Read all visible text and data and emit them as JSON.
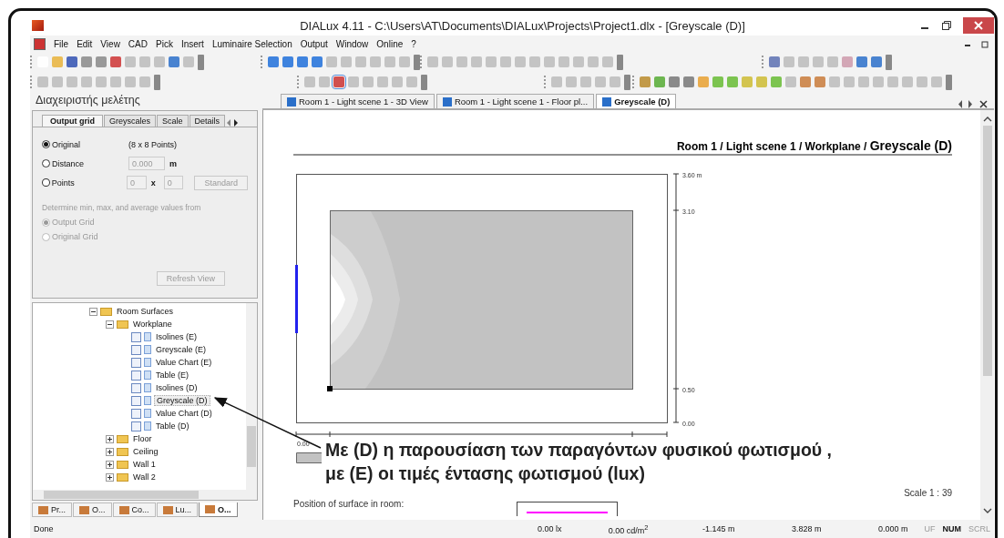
{
  "window": {
    "title": "DIALux 4.11 - C:\\Users\\AT\\Documents\\DIALux\\Projects\\Project1.dlx - [Greyscale (D)]"
  },
  "menu": [
    "File",
    "Edit",
    "View",
    "CAD",
    "Pick",
    "Insert",
    "Luminaire Selection",
    "Output",
    "Window",
    "Online",
    "?"
  ],
  "sidebar": {
    "title": "Διαχειριστής μελέτης",
    "tabs": [
      {
        "label": "Output grid",
        "selected": true
      },
      {
        "label": "Greyscales",
        "selected": false
      },
      {
        "label": "Scale",
        "selected": false
      },
      {
        "label": "Details",
        "selected": false
      }
    ],
    "grid_options": [
      {
        "label": "Original",
        "selected": true,
        "kind": "info",
        "info": "(8 x 8 Points)"
      },
      {
        "label": "Distance",
        "selected": false,
        "kind": "distance",
        "value": "0.000",
        "unit": "m"
      },
      {
        "label": "Points",
        "selected": false,
        "kind": "points",
        "value_1": "0",
        "separator": "x",
        "value_2": "0",
        "button": "Standard"
      }
    ],
    "note": "Determine min, max, and average values from",
    "source_options": [
      {
        "label": "Output Grid",
        "selected": true,
        "disabled": true
      },
      {
        "label": "Original Grid",
        "selected": false,
        "disabled": true
      }
    ],
    "refresh_button": "Refresh View",
    "tree": [
      {
        "label": "Room Surfaces",
        "kind": "folder",
        "expanded": true,
        "children": [
          {
            "label": "Workplane",
            "kind": "folder",
            "expanded": true,
            "children": [
              {
                "label": "Isolines (E)",
                "kind": "output",
                "checked": false,
                "selected": false
              },
              {
                "label": "Greyscale (E)",
                "kind": "output",
                "checked": false,
                "selected": false
              },
              {
                "label": "Value Chart (E)",
                "kind": "output",
                "checked": false,
                "selected": false
              },
              {
                "label": "Table (E)",
                "kind": "output",
                "checked": false,
                "selected": false
              },
              {
                "label": "Isolines (D)",
                "kind": "output",
                "checked": false,
                "selected": false
              },
              {
                "label": "Greyscale (D)",
                "kind": "output",
                "checked": false,
                "selected": true
              },
              {
                "label": "Value Chart (D)",
                "kind": "output",
                "checked": false,
                "selected": false
              },
              {
                "label": "Table (D)",
                "kind": "output",
                "checked": false,
                "selected": false
              }
            ]
          },
          {
            "label": "Floor",
            "kind": "folder",
            "expanded": false
          },
          {
            "label": "Ceiling",
            "kind": "folder",
            "expanded": false
          },
          {
            "label": "Wall 1",
            "kind": "folder",
            "expanded": false
          },
          {
            "label": "Wall 2",
            "kind": "folder",
            "expanded": false
          }
        ]
      }
    ],
    "bottom_tabs": [
      {
        "label": "Pr...",
        "selected": false
      },
      {
        "label": "O...",
        "selected": false
      },
      {
        "label": "Co...",
        "selected": false
      },
      {
        "label": "Lu...",
        "selected": false
      },
      {
        "label": "O...",
        "selected": true
      }
    ]
  },
  "doc_tabs": [
    {
      "label": "Room 1 - Light scene 1 - 3D View",
      "selected": false
    },
    {
      "label": "Room 1 - Light scene 1 - Floor pl...",
      "selected": false
    },
    {
      "label": "Greyscale (D)",
      "selected": true
    }
  ],
  "document": {
    "heading": "Room 1 / Light scene 1 / Workplane / ",
    "heading_end": "Greyscale (D)",
    "y_labels": [
      "3.60 m",
      "3.10",
      "0.50",
      "0.00"
    ],
    "x_labels": [
      "0.00"
    ],
    "scale": "Scale 1 : 39",
    "position_label": "Position of surface in room:"
  },
  "annotation": {
    "lines": [
      "Με (D)  η παρουσίαση των παραγόντων φυσικού φωτισμού ,",
      "με (E) οι τιμές έντασης φωτισμού (lux)"
    ]
  },
  "status_bar": {
    "message": "Done",
    "values": [
      "0.00 lx",
      "0.00 cd/m$^{2}$",
      "-1.145 m",
      "3.828 m",
      "0.000 m"
    ],
    "indicators": [
      {
        "label": "UF",
        "on": false
      },
      {
        "label": "NUM",
        "on": true
      },
      {
        "label": "SCRL",
        "on": false
      }
    ]
  }
}
